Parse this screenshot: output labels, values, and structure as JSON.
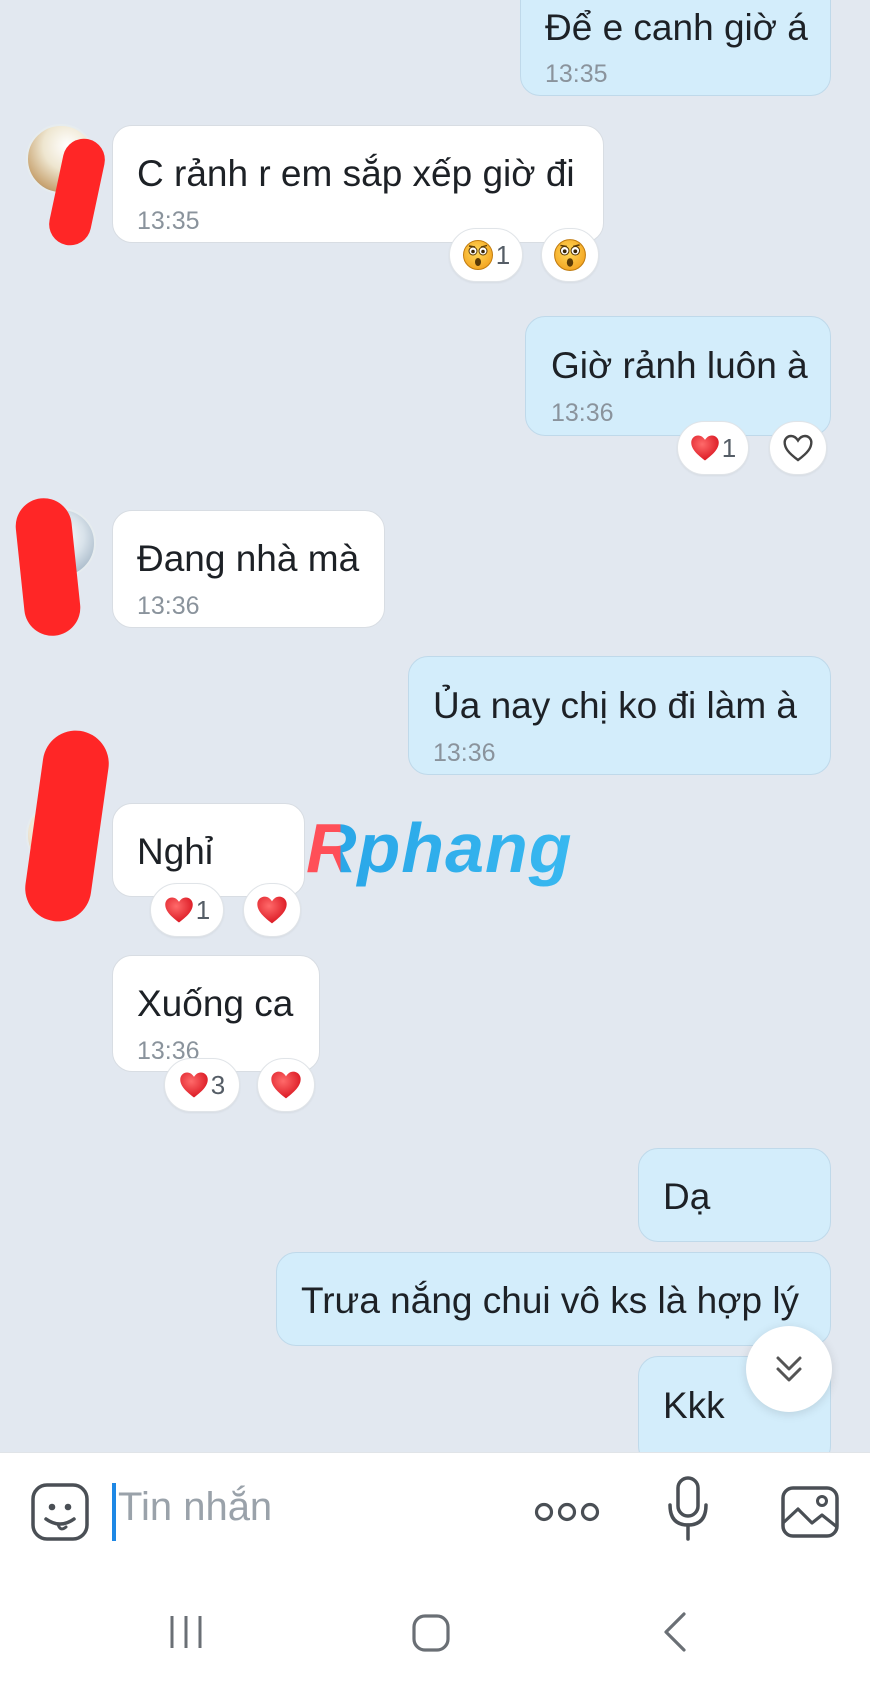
{
  "messages": [
    {
      "text": "Để e canh giờ á",
      "time": "13:35"
    },
    {
      "text": "C rảnh r em sắp xếp giờ đi",
      "time": "13:35",
      "reaction": {
        "icon": "shocked-emoji",
        "count": "1"
      }
    },
    {
      "text": "Giờ rảnh luôn à",
      "time": "13:36",
      "reaction": {
        "icon": "heart",
        "count": "1"
      }
    },
    {
      "text": "Đang nhà mà",
      "time": "13:36"
    },
    {
      "text": "Ủa nay chị ko đi làm à",
      "time": "13:36"
    },
    {
      "text": "Nghỉ",
      "reaction": {
        "icon": "heart",
        "count": "1"
      }
    },
    {
      "text": "Xuống ca",
      "time": "13:36",
      "reaction": {
        "icon": "heart",
        "count": "3"
      }
    },
    {
      "text": "Dạ"
    },
    {
      "text": "Trưa nắng chui vô ks là hợp lý"
    },
    {
      "text": "Kkk"
    }
  ],
  "watermark": "Rphang",
  "input": {
    "placeholder": "Tin nhắn"
  },
  "icons": [
    "sticker-icon",
    "more-icon",
    "microphone-icon",
    "image-icon",
    "scroll-down-icon",
    "recent-apps-icon",
    "home-icon",
    "back-icon",
    "heart-outline-icon"
  ],
  "colors": {
    "sent_bubble": "#d3edfb",
    "received_bubble": "#ffffff",
    "background": "#e2e8f0",
    "heart": "#e8222f",
    "caret": "#1e88e5"
  }
}
